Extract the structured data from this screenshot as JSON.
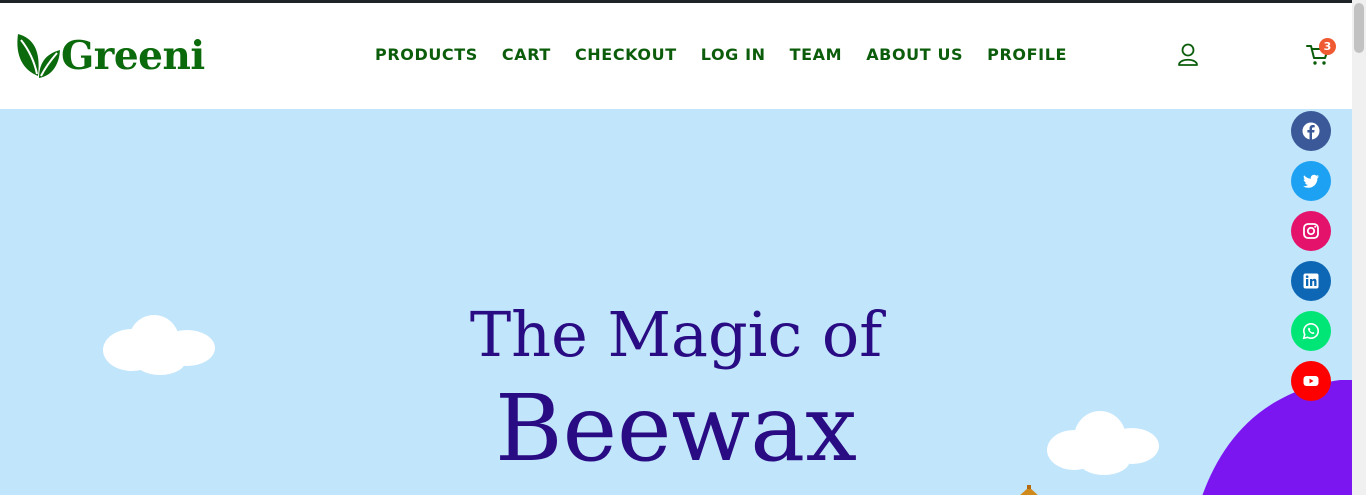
{
  "header": {
    "brand": "Greeni",
    "nav": [
      {
        "label": "PRODUCTS"
      },
      {
        "label": "CART"
      },
      {
        "label": "CHECKOUT"
      },
      {
        "label": "LOG IN"
      },
      {
        "label": "TEAM"
      },
      {
        "label": "ABOUT US"
      },
      {
        "label": "PROFILE"
      }
    ],
    "cart_count": "3",
    "user_icon": "user-icon",
    "cart_icon": "cart-icon"
  },
  "hero": {
    "title_line1": "The Magic of",
    "title_line2": "Beewax"
  },
  "social": [
    {
      "name": "facebook-icon",
      "color": "#3b5998"
    },
    {
      "name": "twitter-icon",
      "color": "#1da1f2"
    },
    {
      "name": "instagram-icon",
      "color": "#e4126b"
    },
    {
      "name": "linkedin-icon",
      "color": "#0e67b5"
    },
    {
      "name": "whatsapp-icon",
      "color": "#00e676"
    },
    {
      "name": "youtube-icon",
      "color": "#ff0000"
    }
  ],
  "colors": {
    "brand_green": "#0b6a0b",
    "hero_bg": "#c1e5fb",
    "hero_text": "#290b83",
    "hill": "#7b16f0",
    "badge": "#f05a33"
  }
}
